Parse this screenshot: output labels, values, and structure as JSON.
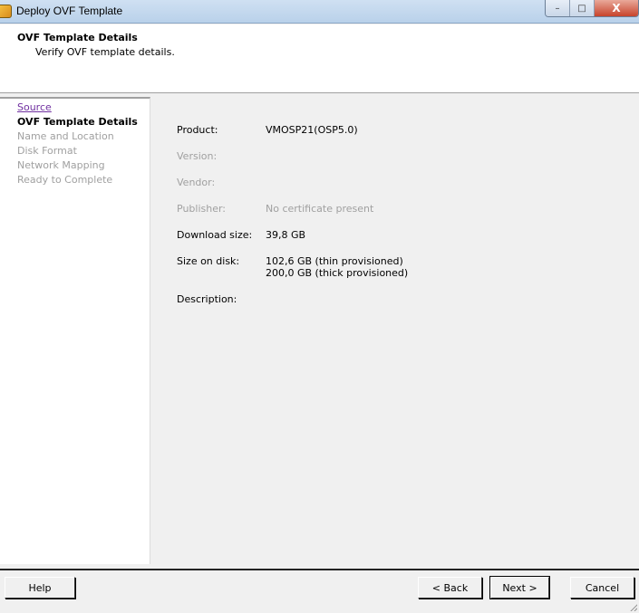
{
  "window": {
    "title": "Deploy OVF Template",
    "minimize": "–",
    "maximize": "□",
    "close": "X"
  },
  "header": {
    "title": "OVF Template Details",
    "subtitle": "Verify OVF template details."
  },
  "steps": [
    {
      "label": "Source",
      "state": "link"
    },
    {
      "label": "OVF Template Details",
      "state": "current"
    },
    {
      "label": "Name and Location",
      "state": "pending"
    },
    {
      "label": "Disk Format",
      "state": "pending"
    },
    {
      "label": "Network Mapping",
      "state": "pending"
    },
    {
      "label": "Ready to Complete",
      "state": "pending"
    }
  ],
  "details": {
    "product": {
      "label": "Product:",
      "value": "VMOSP21(OSP5.0)"
    },
    "version": {
      "label": "Version:",
      "value": ""
    },
    "vendor": {
      "label": "Vendor:",
      "value": ""
    },
    "publisher": {
      "label": "Publisher:",
      "value": "No certificate present"
    },
    "download_size": {
      "label": "Download size:",
      "value": "39,8 GB"
    },
    "size_on_disk": {
      "label": "Size on disk:",
      "thin": "102,6 GB (thin provisioned)",
      "thick": "200,0 GB (thick provisioned)"
    },
    "description": {
      "label": "Description:",
      "value": ""
    }
  },
  "buttons": {
    "help": "Help",
    "back": "< Back",
    "next": "Next >",
    "cancel": "Cancel"
  }
}
